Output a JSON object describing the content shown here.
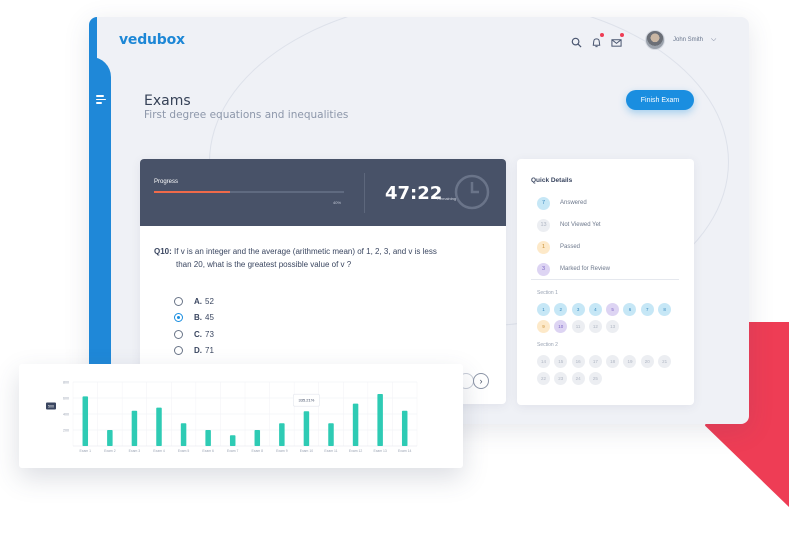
{
  "app": {
    "logo": "vedubox",
    "user_name": "John Smith"
  },
  "header": {
    "icons": [
      "search-icon",
      "bell-icon",
      "mail-icon"
    ],
    "title": "Exams",
    "subtitle": "First degree equations and inequalities",
    "finish_button": "Finish Exam"
  },
  "progress": {
    "label": "Progress",
    "value_percent": 40,
    "value_text": "40%",
    "timer": "47:22",
    "remaining_label": "Remaining"
  },
  "question": {
    "number": "Q10:",
    "text_line1": "If v is an integer and the average (arithmetic mean) of 1, 2, 3, and v is less",
    "text_line2": "than 20, what is the greatest possible value of v ?",
    "options": [
      {
        "letter": "A.",
        "value": "52",
        "selected": false
      },
      {
        "letter": "B.",
        "value": "45",
        "selected": true
      },
      {
        "letter": "C.",
        "value": "73",
        "selected": false
      },
      {
        "letter": "D.",
        "value": "71",
        "selected": false
      }
    ],
    "next_icon": "›"
  },
  "quick_details": {
    "title": "Quick Details",
    "legend": [
      {
        "count": "7",
        "label": "Answered",
        "status": "answered"
      },
      {
        "count": "13",
        "label": "Not Viewed Yet",
        "status": "notviewed"
      },
      {
        "count": "1",
        "label": "Passed",
        "status": "passed"
      },
      {
        "count": "3",
        "label": "Marked for Review",
        "status": "marked"
      }
    ],
    "sections": [
      {
        "label": "Section 1",
        "cells": [
          {
            "n": "1",
            "status": "answered"
          },
          {
            "n": "2",
            "status": "answered"
          },
          {
            "n": "3",
            "status": "answered"
          },
          {
            "n": "4",
            "status": "answered"
          },
          {
            "n": "5",
            "status": "marked"
          },
          {
            "n": "6",
            "status": "answered"
          },
          {
            "n": "7",
            "status": "answered"
          },
          {
            "n": "8",
            "status": "answered"
          },
          {
            "n": "9",
            "status": "passed"
          },
          {
            "n": "10",
            "status": "marked"
          },
          {
            "n": "11",
            "status": "notviewed"
          },
          {
            "n": "12",
            "status": "notviewed"
          },
          {
            "n": "13",
            "status": "notviewed"
          }
        ]
      },
      {
        "label": "Section 2",
        "cells": [
          {
            "n": "14",
            "status": "notviewed"
          },
          {
            "n": "15",
            "status": "notviewed"
          },
          {
            "n": "16",
            "status": "notviewed"
          },
          {
            "n": "17",
            "status": "notviewed"
          },
          {
            "n": "18",
            "status": "notviewed"
          },
          {
            "n": "19",
            "status": "notviewed"
          },
          {
            "n": "20",
            "status": "notviewed"
          },
          {
            "n": "21",
            "status": "notviewed"
          },
          {
            "n": "22",
            "status": "notviewed"
          },
          {
            "n": "23",
            "status": "notviewed"
          },
          {
            "n": "24",
            "status": "notviewed"
          },
          {
            "n": "25",
            "status": "notviewed"
          }
        ]
      }
    ]
  },
  "colors": {
    "brand": "#1d87d6",
    "accent_red": "#ee3d55",
    "bar": "#2ecbb4",
    "progress_fill": "#f06a4a"
  },
  "chart_data": {
    "type": "bar",
    "categories": [
      "Exam 1",
      "Exam 2",
      "Exam 3",
      "Exam 4",
      "Exam 5",
      "Exam 6",
      "Exam 7",
      "Exam 8",
      "Exam 9",
      "Exam 10",
      "Exam 11",
      "Exam 12",
      "Exam 13",
      "Exam 14"
    ],
    "values": [
      620,
      200,
      440,
      480,
      285,
      200,
      135,
      200,
      285,
      435,
      285,
      530,
      650,
      440
    ],
    "ylim": [
      0,
      800
    ],
    "yticks": [
      "200",
      "400",
      "600",
      "800"
    ],
    "tooltip": {
      "category": "Exam 10",
      "text": "335.21%"
    },
    "highlight_label": "500",
    "grid": true
  }
}
